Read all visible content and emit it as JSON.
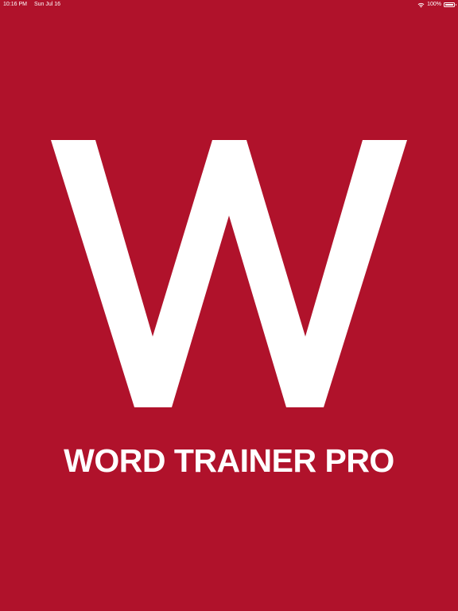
{
  "status_bar": {
    "time": "10:16 PM",
    "date": "Sun Jul 16",
    "battery_percent": "100%",
    "battery_level": 1.0
  },
  "icons": {
    "wifi": "wifi-icon",
    "battery": "battery-icon"
  },
  "splash": {
    "logo_letter": "W",
    "title": "WORD TRAINER PRO"
  },
  "colors": {
    "background": "#b0122b",
    "foreground": "#ffffff"
  }
}
